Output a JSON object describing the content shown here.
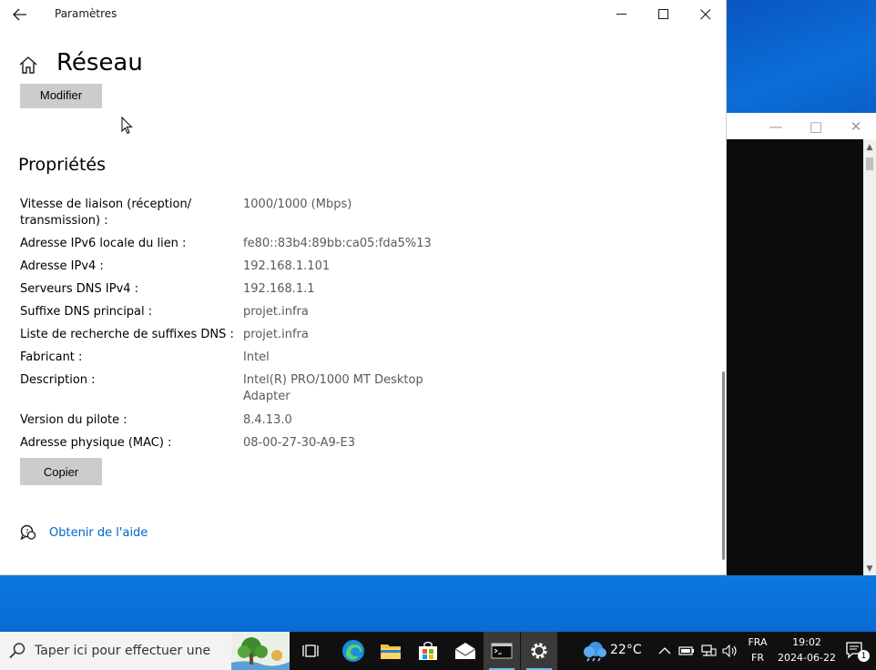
{
  "window": {
    "app_title": "Paramètres",
    "page_title": "Réseau",
    "modify_label": "Modifier",
    "section_title": "Propriétés",
    "properties": [
      {
        "label": "Vitesse de liaison (réception/ transmission) :",
        "value": "1000/1000 (Mbps)"
      },
      {
        "label": "Adresse IPv6 locale du lien :",
        "value": "fe80::83b4:89bb:ca05:fda5%13"
      },
      {
        "label": "Adresse IPv4 :",
        "value": "192.168.1.101"
      },
      {
        "label": "Serveurs DNS IPv4 :",
        "value": "192.168.1.1"
      },
      {
        "label": "Suffixe DNS principal :",
        "value": "projet.infra"
      },
      {
        "label": "Liste de recherche de suffixes DNS :",
        "value": "projet.infra"
      },
      {
        "label": "Fabricant :",
        "value": "Intel"
      },
      {
        "label": "Description :",
        "value": "Intel(R) PRO/1000 MT Desktop Adapter"
      },
      {
        "label": "Version du pilote :",
        "value": "8.4.13.0"
      },
      {
        "label": "Adresse physique (MAC) :",
        "value": "08-00-27-30-A9-E3"
      }
    ],
    "copy_label": "Copier",
    "help_label": "Obtenir de l'aide"
  },
  "taskbar": {
    "search_placeholder": "Taper ici pour effectuer une",
    "weather": "22°C",
    "lang_top": "FRA",
    "lang_bottom": "FR",
    "time": "19:02",
    "date": "2024-06-22",
    "notification_count": "1",
    "icons": [
      "task-view-icon",
      "edge-icon",
      "file-explorer-icon",
      "store-icon",
      "mail-icon",
      "terminal-icon",
      "settings-icon"
    ]
  },
  "colors": {
    "link": "#0064c8",
    "button_bg": "#cccccc",
    "taskbar_bg": "#101010",
    "desktop_bg": "#0a63c9"
  }
}
